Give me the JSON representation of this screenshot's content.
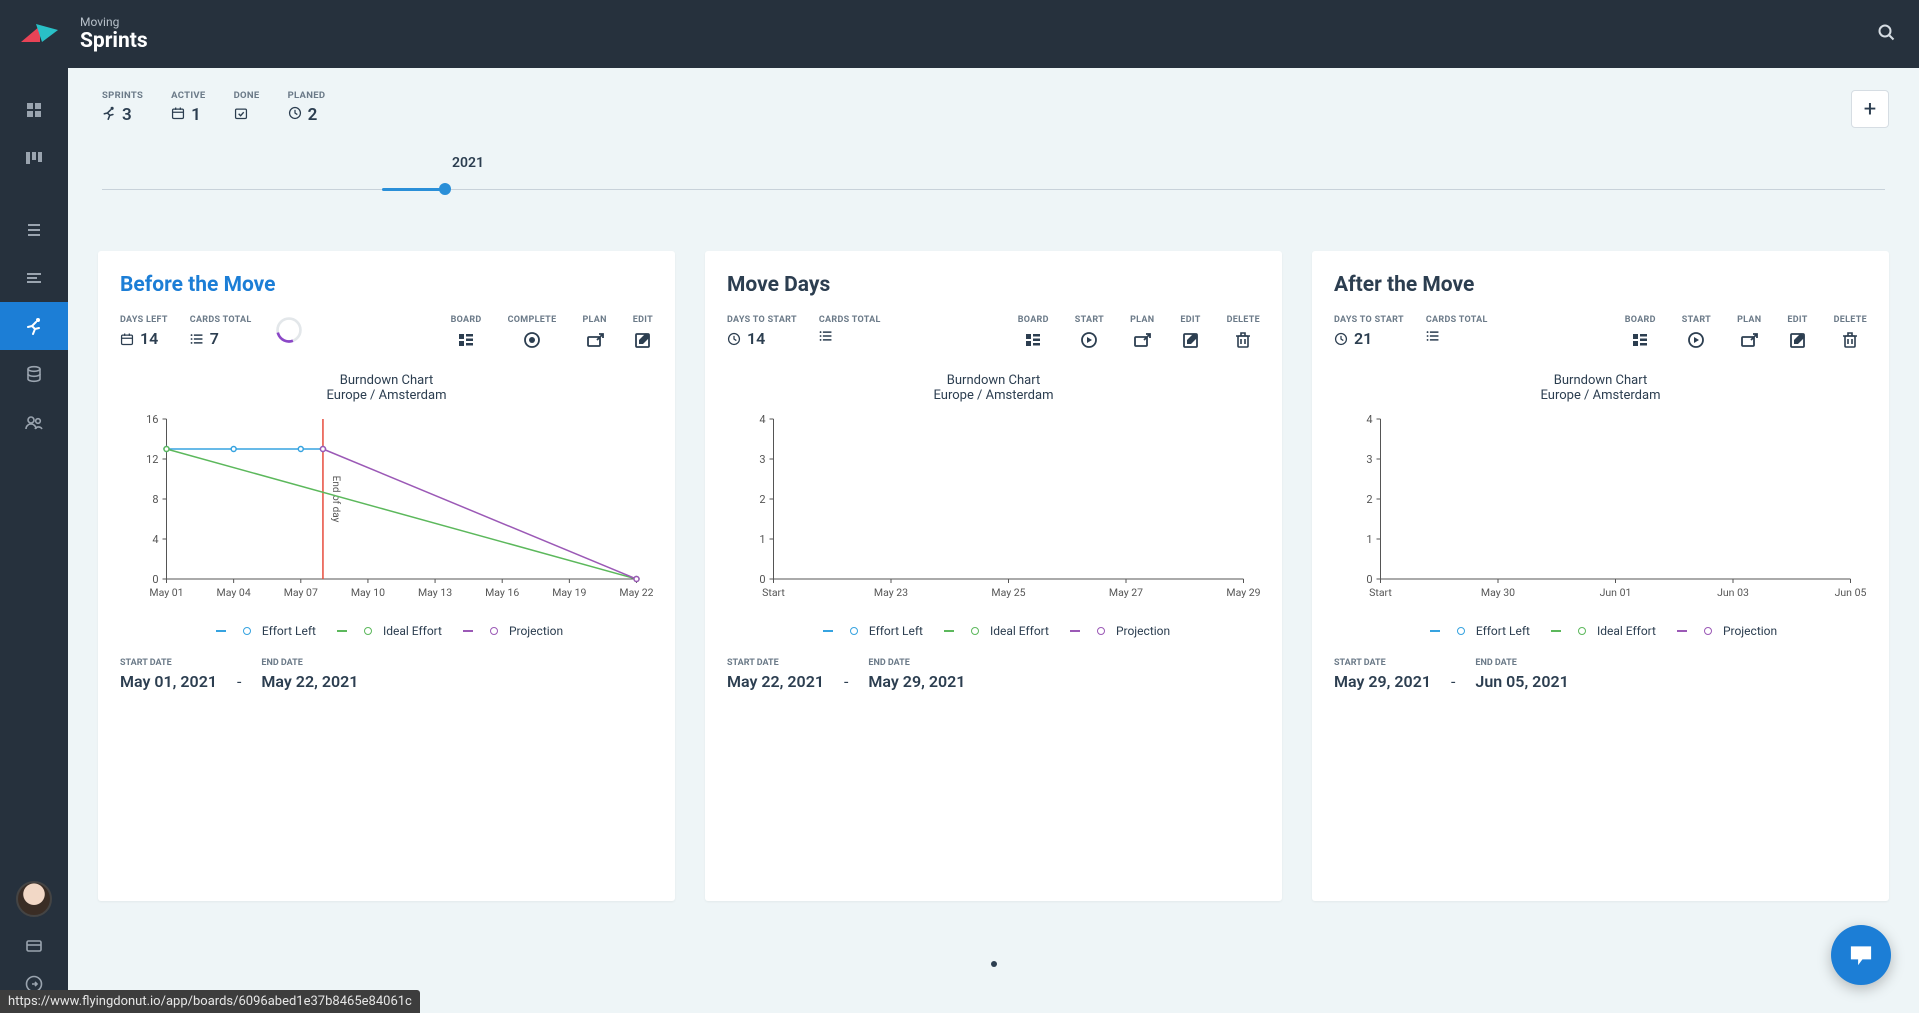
{
  "header": {
    "breadcrumb": "Moving",
    "title": "Sprints"
  },
  "summary": {
    "sprints": {
      "label": "SPRINTS",
      "value": "3"
    },
    "active": {
      "label": "ACTIVE",
      "value": "1"
    },
    "done": {
      "label": "DONE",
      "value": ""
    },
    "planned": {
      "label": "PLANED",
      "value": "2"
    }
  },
  "timeline": {
    "year": "2021",
    "progress_pct": 5.0
  },
  "sprints": [
    {
      "id": "before",
      "title": "Before the Move",
      "title_active": true,
      "meta1": {
        "label": "DAYS LEFT",
        "value": "14",
        "icon": "calendar"
      },
      "meta2": {
        "label": "CARDS TOTAL",
        "value": "7",
        "icon": "list"
      },
      "has_progress_ring": true,
      "actions": [
        {
          "label": "BOARD",
          "icon": "board",
          "name": "board-button"
        },
        {
          "label": "COMPLETE",
          "icon": "complete",
          "name": "complete-button"
        },
        {
          "label": "PLAN",
          "icon": "plan",
          "name": "plan-button"
        },
        {
          "label": "EDIT",
          "icon": "edit",
          "name": "edit-button"
        }
      ],
      "chart_title": "Burndown Chart",
      "chart_sub": "Europe / Amsterdam",
      "start_label": "START DATE",
      "start_date": "May 01, 2021",
      "end_label": "END DATE",
      "end_date": "May 22, 2021"
    },
    {
      "id": "move",
      "title": "Move Days",
      "title_active": false,
      "meta1": {
        "label": "DAYS TO START",
        "value": "14",
        "icon": "clock"
      },
      "meta2": {
        "label": "CARDS TOTAL",
        "value": "",
        "icon": "list"
      },
      "has_progress_ring": false,
      "actions": [
        {
          "label": "BOARD",
          "icon": "board",
          "name": "board-button"
        },
        {
          "label": "START",
          "icon": "start",
          "name": "start-button"
        },
        {
          "label": "PLAN",
          "icon": "plan",
          "name": "plan-button"
        },
        {
          "label": "EDIT",
          "icon": "edit",
          "name": "edit-button"
        },
        {
          "label": "DELETE",
          "icon": "delete",
          "name": "delete-button"
        }
      ],
      "chart_title": "Burndown Chart",
      "chart_sub": "Europe / Amsterdam",
      "start_label": "START DATE",
      "start_date": "May 22, 2021",
      "end_label": "END DATE",
      "end_date": "May 29, 2021"
    },
    {
      "id": "after",
      "title": "After the Move",
      "title_active": false,
      "meta1": {
        "label": "DAYS TO START",
        "value": "21",
        "icon": "clock"
      },
      "meta2": {
        "label": "CARDS TOTAL",
        "value": "",
        "icon": "list"
      },
      "has_progress_ring": false,
      "actions": [
        {
          "label": "BOARD",
          "icon": "board",
          "name": "board-button"
        },
        {
          "label": "START",
          "icon": "start",
          "name": "start-button"
        },
        {
          "label": "PLAN",
          "icon": "plan",
          "name": "plan-button"
        },
        {
          "label": "EDIT",
          "icon": "edit",
          "name": "edit-button"
        },
        {
          "label": "DELETE",
          "icon": "delete",
          "name": "delete-button"
        }
      ],
      "chart_title": "Burndown Chart",
      "chart_sub": "Europe / Amsterdam",
      "start_label": "START DATE",
      "start_date": "May 29, 2021",
      "end_label": "END DATE",
      "end_date": "Jun 05, 2021"
    }
  ],
  "legend": {
    "effort": "Effort Left",
    "ideal": "Ideal Effort",
    "proj": "Projection"
  },
  "status_url": "https://www.flyingdonut.io/app/boards/6096abed1e37b8465e84061c",
  "colors": {
    "accent": "#1c7ed6",
    "dark": "#26313d",
    "blue": "#36a3e0",
    "green": "#5cb85c",
    "purple": "#9b59b6",
    "red": "#e74c3c",
    "ring": "#8b47c7"
  },
  "chart_data": [
    {
      "sprint": "before",
      "type": "line",
      "title": "Burndown Chart",
      "subtitle": "Europe / Amsterdam",
      "ylim": [
        0,
        16
      ],
      "yticks": [
        0,
        4,
        8,
        12,
        16
      ],
      "xticks": [
        "May 01",
        "May 04",
        "May 07",
        "May 10",
        "May 13",
        "May 16",
        "May 19",
        "May 22"
      ],
      "current_marker": {
        "x": "May 08",
        "label": "End of day"
      },
      "series": [
        {
          "name": "Effort Left",
          "color": "#36a3e0",
          "points": [
            [
              0,
              13
            ],
            [
              1,
              13
            ],
            [
              2,
              13
            ],
            [
              2.33,
              13
            ]
          ]
        },
        {
          "name": "Ideal Effort",
          "color": "#5cb85c",
          "points": [
            [
              0,
              13
            ],
            [
              7,
              0
            ]
          ]
        },
        {
          "name": "Projection",
          "color": "#9b59b6",
          "points": [
            [
              2.33,
              13
            ],
            [
              7,
              0
            ]
          ]
        }
      ]
    },
    {
      "sprint": "move",
      "type": "line",
      "title": "Burndown Chart",
      "subtitle": "Europe / Amsterdam",
      "ylim": [
        0,
        4
      ],
      "yticks": [
        0,
        1,
        2,
        3,
        4
      ],
      "xticks": [
        "Start",
        "May 23",
        "May 25",
        "May 27",
        "May 29"
      ],
      "series": []
    },
    {
      "sprint": "after",
      "type": "line",
      "title": "Burndown Chart",
      "subtitle": "Europe / Amsterdam",
      "ylim": [
        0,
        4
      ],
      "yticks": [
        0,
        1,
        2,
        3,
        4
      ],
      "xticks": [
        "Start",
        "May 30",
        "Jun 01",
        "Jun 03",
        "Jun 05"
      ],
      "series": []
    }
  ]
}
